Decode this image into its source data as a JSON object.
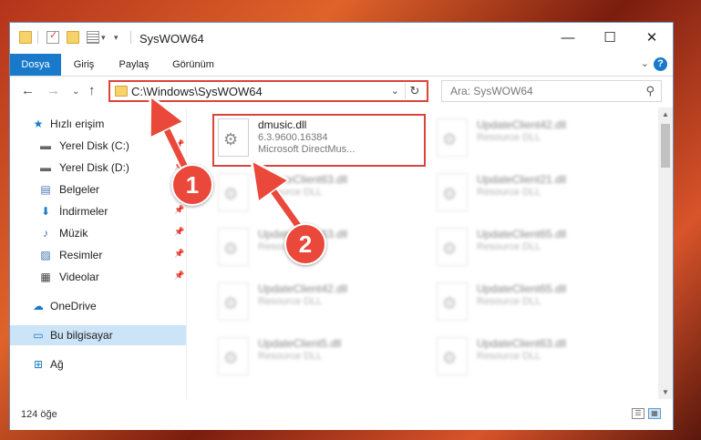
{
  "window": {
    "title": "SysWOW64",
    "controls": {
      "minimize": "—",
      "maximize": "☐",
      "close": "✕"
    }
  },
  "ribbon": {
    "tabs": [
      {
        "label": "Dosya",
        "active": true
      },
      {
        "label": "Giriş"
      },
      {
        "label": "Paylaş"
      },
      {
        "label": "Görünüm"
      }
    ],
    "expand": "⌄",
    "help": "?"
  },
  "navigation": {
    "back": "←",
    "forward": "→",
    "recent": "⌄",
    "up": "↑",
    "address": "C:\\Windows\\SysWOW64",
    "address_dropdown": "⌄",
    "refresh": "↻",
    "search_placeholder": "Ara: SysWOW64",
    "search_icon": "⚲"
  },
  "sidebar": {
    "items": [
      {
        "label": "Hızlı erişim",
        "icon": "star-icon",
        "glyph": "★",
        "pinned": false
      },
      {
        "label": "Yerel Disk (C:)",
        "icon": "drive-icon",
        "glyph": "▬",
        "pinned": true
      },
      {
        "label": "Yerel Disk (D:)",
        "icon": "drive-icon",
        "glyph": "▬",
        "pinned": true
      },
      {
        "label": "Belgeler",
        "icon": "documents-icon",
        "glyph": "▤",
        "pinned": true
      },
      {
        "label": "İndirmeler",
        "icon": "download-icon",
        "glyph": "⬇",
        "pinned": true
      },
      {
        "label": "Müzik",
        "icon": "music-icon",
        "glyph": "♪",
        "pinned": true
      },
      {
        "label": "Resimler",
        "icon": "pictures-icon",
        "glyph": "▨",
        "pinned": true
      },
      {
        "label": "Videolar",
        "icon": "video-icon",
        "glyph": "▦",
        "pinned": true
      },
      {
        "label": "OneDrive",
        "icon": "cloud-icon",
        "glyph": "☁",
        "pinned": false
      },
      {
        "label": "Bu bilgisayar",
        "icon": "computer-icon",
        "glyph": "▭",
        "pinned": false,
        "selected": true
      },
      {
        "label": "Ağ",
        "icon": "network-icon",
        "glyph": "⊞",
        "pinned": false
      }
    ],
    "pin_glyph": "📌"
  },
  "files": {
    "highlighted": {
      "name": "dmusic.dll",
      "version": "6.3.9600.16384",
      "description": "Microsoft DirectMus..."
    },
    "blurred": [
      {
        "name": "UpdateClient63.dll",
        "sub": "Resource DLL"
      },
      {
        "name": "UpdateClient63.dll",
        "sub": "Resource DLL"
      },
      {
        "name": "UpdateClient42.dll",
        "sub": "Resource DLL"
      },
      {
        "name": "UpdateClient5.dll",
        "sub": "Resource DLL"
      },
      {
        "name": "UpdateClient42.dll",
        "sub": "Resource DLL"
      },
      {
        "name": "UpdateClient21.dll",
        "sub": "Resource DLL"
      },
      {
        "name": "UpdateClient65.dll",
        "sub": "Resource DLL"
      },
      {
        "name": "UpdateClient65.dll",
        "sub": "Resource DLL"
      },
      {
        "name": "UpdateClient63.dll",
        "sub": "Resource DLL"
      }
    ]
  },
  "status": {
    "count": "124 öğe"
  },
  "annotations": {
    "badge1": "1",
    "badge2": "2",
    "color": "#e9483a"
  }
}
